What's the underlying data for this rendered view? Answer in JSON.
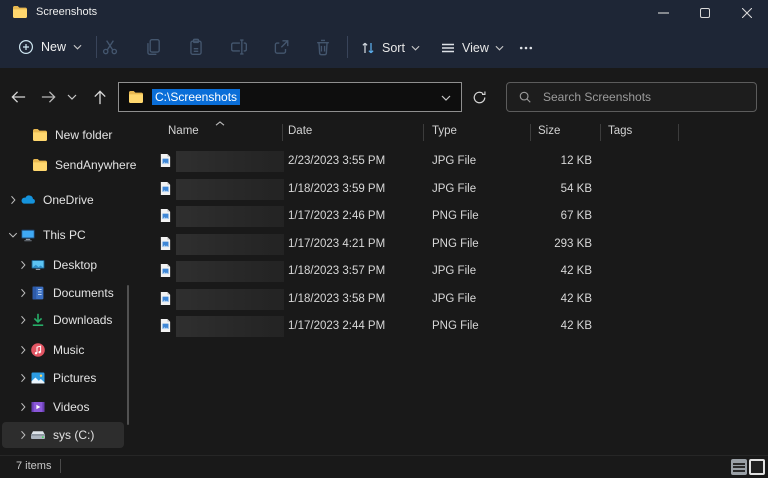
{
  "window": {
    "title": "Screenshots"
  },
  "titlebar": {
    "controls": [
      {
        "name": "minimize"
      },
      {
        "name": "maximize"
      },
      {
        "name": "close"
      }
    ]
  },
  "toolbar": {
    "new_label": "New",
    "sort_label": "Sort",
    "view_label": "View",
    "disabled_icons": [
      "cut-icon",
      "copy-icon",
      "paste-icon",
      "rename-icon",
      "share-icon",
      "delete-icon"
    ],
    "more_icon": "more-icon"
  },
  "addressbar": {
    "path": "C:\\Screenshots",
    "path_selected": true,
    "search_placeholder": "Search Screenshots",
    "nav_icons": [
      "back-icon",
      "forward-icon",
      "history-chevron-icon",
      "up-icon",
      "refresh-icon"
    ]
  },
  "sidebar": {
    "items": [
      {
        "label": "New folder",
        "icon": "folder-icon",
        "chevron": "none",
        "selected": false
      },
      {
        "label": "SendAnywhere",
        "icon": "folder-icon",
        "chevron": "none",
        "selected": false
      },
      {
        "label": "OneDrive",
        "icon": "onedrive-icon",
        "chevron": "right",
        "selected": false
      },
      {
        "label": "This PC",
        "icon": "this-pc-icon",
        "chevron": "down",
        "selected": false
      },
      {
        "label": "Desktop",
        "icon": "desktop-icon",
        "chevron": "right",
        "selected": false
      },
      {
        "label": "Documents",
        "icon": "documents-icon",
        "chevron": "right",
        "selected": false
      },
      {
        "label": "Downloads",
        "icon": "downloads-icon",
        "chevron": "right",
        "selected": false
      },
      {
        "label": "Music",
        "icon": "music-icon",
        "chevron": "right",
        "selected": false
      },
      {
        "label": "Pictures",
        "icon": "pictures-icon",
        "chevron": "right",
        "selected": false
      },
      {
        "label": "Videos",
        "icon": "videos-icon",
        "chevron": "right",
        "selected": false
      },
      {
        "label": "sys (C:)",
        "icon": "drive-icon",
        "chevron": "right",
        "selected": true
      }
    ]
  },
  "filelist": {
    "columns": [
      "Name",
      "Date",
      "Type",
      "Size",
      "Tags"
    ],
    "sort_column": "Name",
    "sort_ascending": true,
    "rows": [
      {
        "name_redacted": true,
        "icon": "image-file-icon",
        "date": "2/23/2023 3:55 PM",
        "type": "JPG File",
        "size": "12 KB"
      },
      {
        "name_redacted": true,
        "icon": "image-file-icon",
        "date": "1/18/2023 3:59 PM",
        "type": "JPG File",
        "size": "54 KB"
      },
      {
        "name_redacted": true,
        "icon": "image-file-icon",
        "date": "1/17/2023 2:46 PM",
        "type": "PNG File",
        "size": "67 KB"
      },
      {
        "name_redacted": true,
        "icon": "image-file-icon",
        "date": "1/17/2023 4:21 PM",
        "type": "PNG File",
        "size": "293 KB"
      },
      {
        "name_redacted": true,
        "icon": "image-file-icon",
        "date": "1/18/2023 3:57 PM",
        "type": "JPG File",
        "size": "42 KB"
      },
      {
        "name_redacted": true,
        "icon": "image-file-icon",
        "date": "1/18/2023 3:58 PM",
        "type": "JPG File",
        "size": "42 KB"
      },
      {
        "name_redacted": true,
        "icon": "image-file-icon",
        "date": "1/17/2023 2:44 PM",
        "type": "PNG File",
        "size": "42 KB"
      }
    ]
  },
  "statusbar": {
    "items_count": "7 items"
  },
  "colors": {
    "titlebar_bg": "#1e2636",
    "window_bg": "#191919",
    "selection_blue": "#0a6ed8",
    "folder_yellow": "#ffd76e",
    "disabled_icon": "#44566e"
  }
}
